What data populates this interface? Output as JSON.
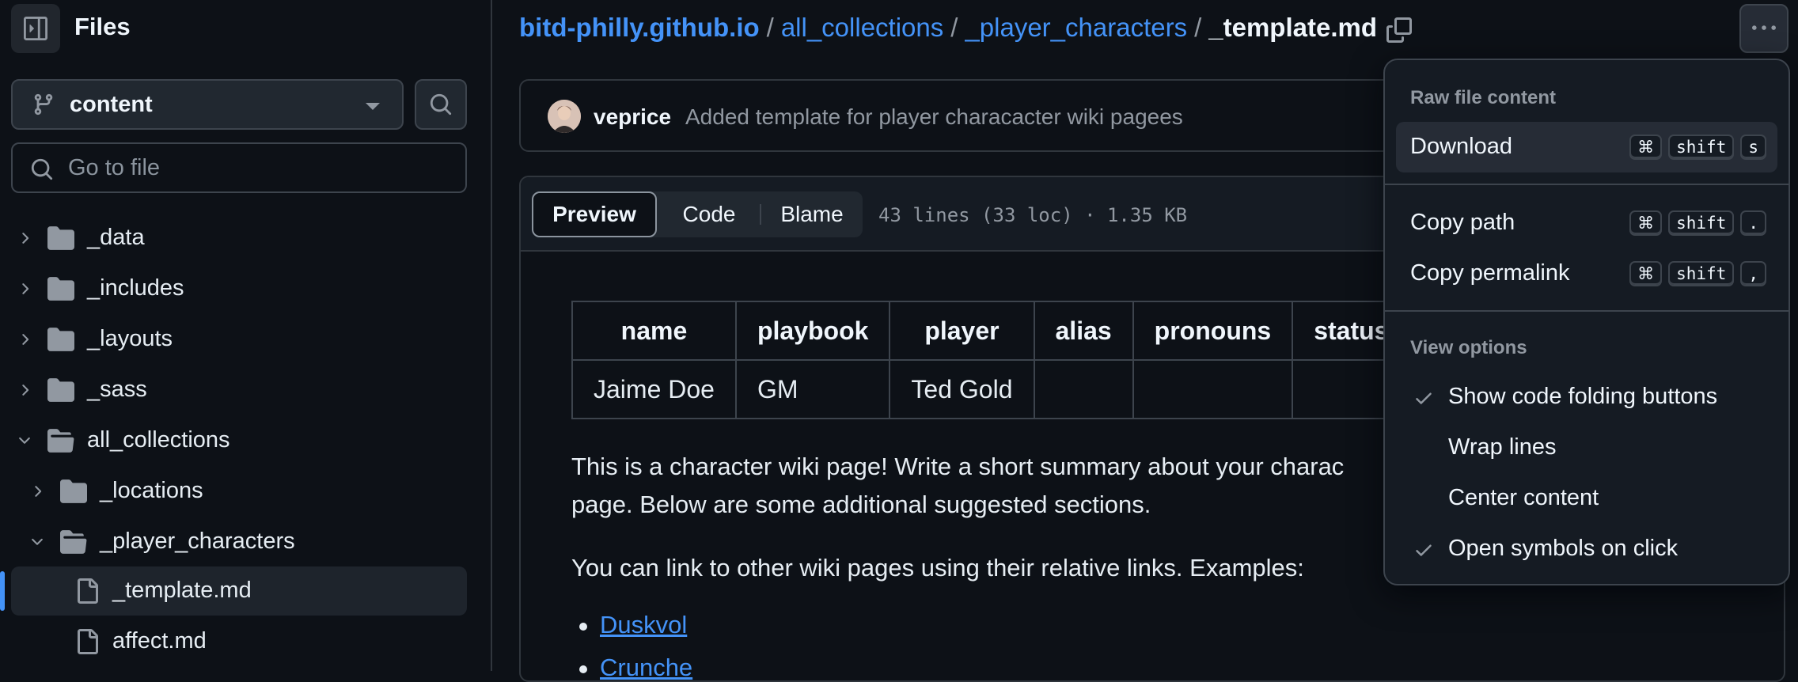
{
  "sidebar": {
    "title": "Files",
    "branch": "content",
    "go_to_file_placeholder": "Go to file",
    "tree": [
      {
        "label": "_data",
        "type": "folder",
        "expanded": false,
        "depth": 0
      },
      {
        "label": "_includes",
        "type": "folder",
        "expanded": false,
        "depth": 0
      },
      {
        "label": "_layouts",
        "type": "folder",
        "expanded": false,
        "depth": 0
      },
      {
        "label": "_sass",
        "type": "folder",
        "expanded": false,
        "depth": 0
      },
      {
        "label": "all_collections",
        "type": "folder",
        "expanded": true,
        "depth": 0
      },
      {
        "label": "_locations",
        "type": "folder",
        "expanded": false,
        "depth": 1
      },
      {
        "label": "_player_characters",
        "type": "folder",
        "expanded": true,
        "depth": 1
      },
      {
        "label": "_template.md",
        "type": "file",
        "selected": true,
        "depth": 2
      },
      {
        "label": "affect.md",
        "type": "file",
        "depth": 2
      }
    ]
  },
  "breadcrumb": {
    "repo": "bitd-philly.github.io",
    "sep": "/",
    "parts": [
      "all_collections",
      "_player_characters"
    ],
    "current": "_template.md"
  },
  "commit": {
    "author": "veprice",
    "message": "Added template for player characacter wiki pagees"
  },
  "file": {
    "tabs": [
      "Preview",
      "Code",
      "Blame"
    ],
    "active_tab": "Preview",
    "stats": "43 lines (33 loc) · 1.35 KB",
    "table": {
      "headers": [
        "name",
        "playbook",
        "player",
        "alias",
        "pronouns",
        "status"
      ],
      "rows": [
        [
          "Jaime Doe",
          "GM",
          "Ted Gold",
          "",
          "",
          ""
        ]
      ]
    },
    "paragraph1_line1": "This is a character wiki page! Write a short summary about your charac",
    "paragraph1_line2": "page. Below are some additional suggested sections.",
    "paragraph2": "You can link to other wiki pages using their relative links. Examples:",
    "links": [
      "Duskvol",
      "Crunche"
    ]
  },
  "menu": {
    "group1_title": "Raw file content",
    "download": "Download",
    "copy_path": "Copy path",
    "copy_permalink": "Copy permalink",
    "group2_title": "View options",
    "show_folding": "Show code folding buttons",
    "wrap_lines": "Wrap lines",
    "center_content": "Center content",
    "open_symbols": "Open symbols on click",
    "shortcut_cmd": "⌘",
    "shortcut_shift": "shift",
    "download_key": "s",
    "copy_path_key": ".",
    "copy_permalink_key": ",",
    "checked": {
      "show_folding": true,
      "wrap_lines": false,
      "center_content": false,
      "open_symbols": true
    }
  },
  "colors": {
    "background": "#0d1117",
    "link": "#4493f8",
    "border": "#30363d",
    "muted": "#9198a1"
  },
  "icons": [
    "sidebar-collapse-icon",
    "git-branch-icon",
    "search-icon",
    "chevron-right-icon",
    "chevron-down-icon",
    "folder-icon",
    "folder-open-icon",
    "file-icon",
    "copy-icon",
    "kebab-horizontal-icon",
    "check-icon"
  ]
}
